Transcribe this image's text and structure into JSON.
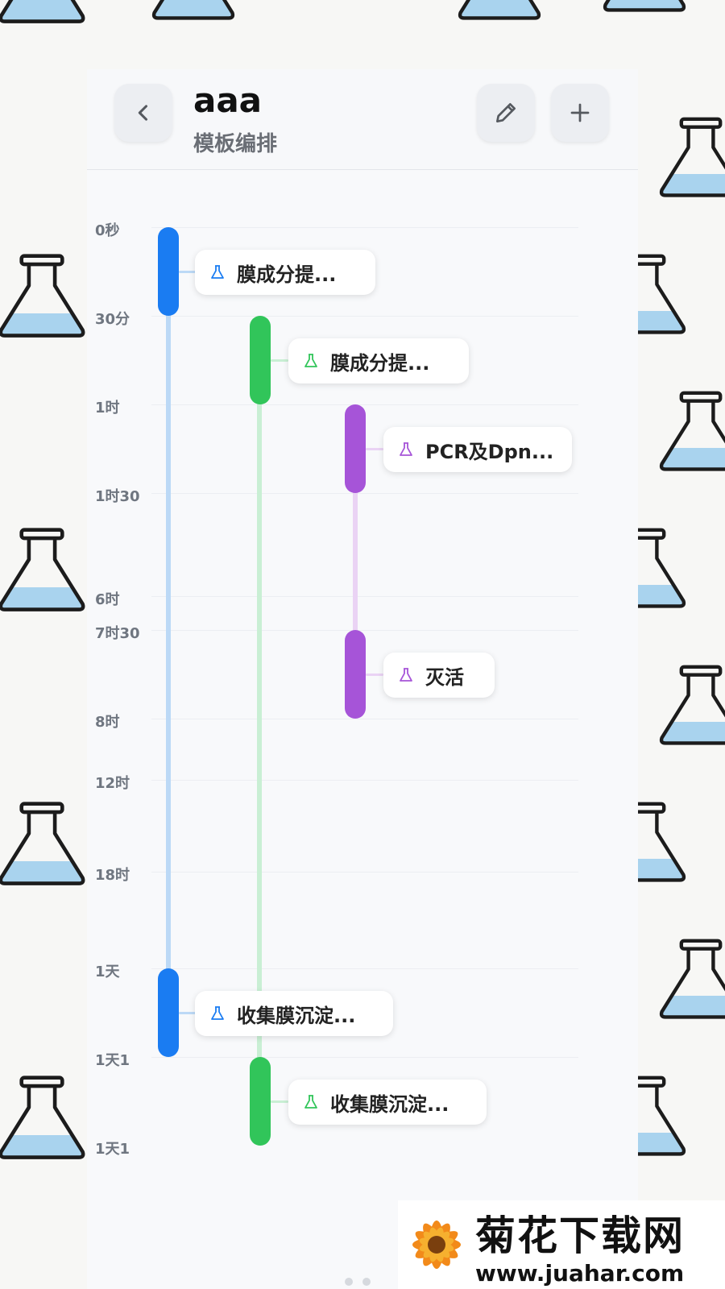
{
  "header": {
    "title": "aaa",
    "subtitle": "模板编排",
    "back_icon": "chevron-left-icon",
    "edit_icon": "pencil-icon",
    "add_icon": "plus-icon"
  },
  "timeline": {
    "time_labels": [
      "0秒",
      "30分",
      "1时",
      "1时30",
      "6时",
      "7时30",
      "8时",
      "12时",
      "18时",
      "1天",
      "1天1",
      "1天1"
    ],
    "tasks": [
      {
        "label": "膜成分提...",
        "color": "#1a7cf2",
        "icon": "flask-icon"
      },
      {
        "label": "膜成分提...",
        "color": "#31c55a",
        "icon": "flask-icon"
      },
      {
        "label": "PCR及Dpn...",
        "color": "#a654d8",
        "icon": "flask-icon"
      },
      {
        "label": "灭活",
        "color": "#a654d8",
        "icon": "flask-icon"
      },
      {
        "label": "收集膜沉淀...",
        "color": "#1a7cf2",
        "icon": "flask-icon"
      },
      {
        "label": "收集膜沉淀...",
        "color": "#31c55a",
        "icon": "flask-icon"
      }
    ],
    "track_colors": {
      "blue": "#bcd9f6",
      "green": "#c9efd4",
      "purple": "#ead3f4"
    }
  },
  "watermark": {
    "title": "菊花下载网",
    "url": "www.juahar.com"
  }
}
